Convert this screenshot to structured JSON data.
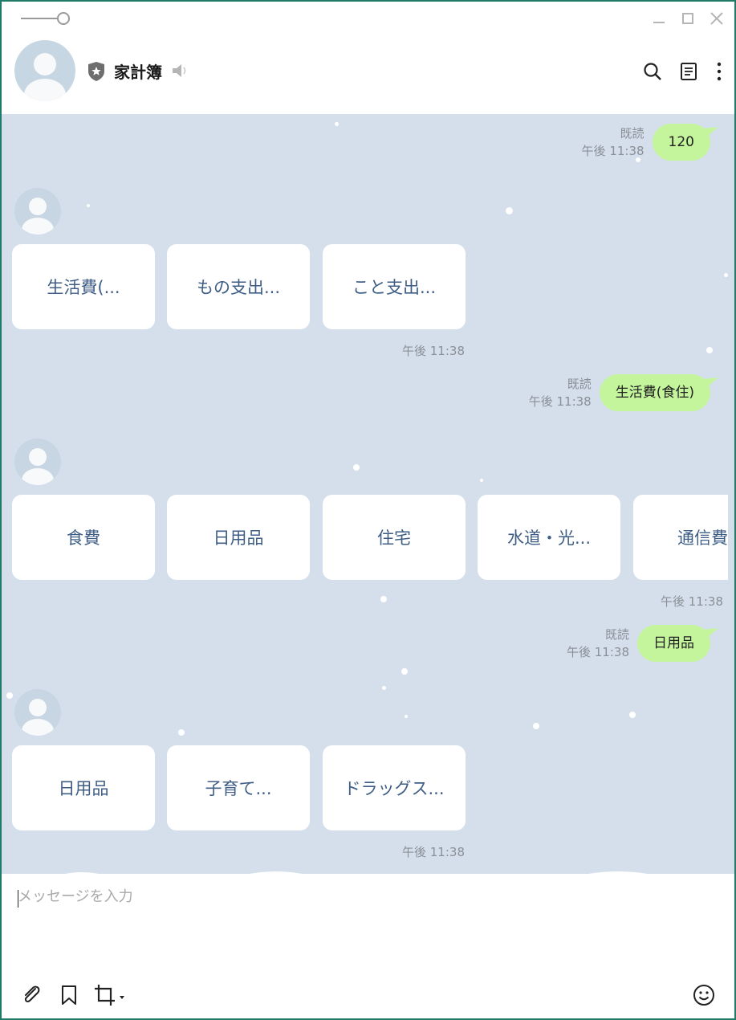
{
  "header": {
    "title": "家計簿"
  },
  "messages": [
    {
      "read": "既読",
      "time": "午後 11:38",
      "text": "120"
    },
    {
      "read": "既読",
      "time": "午後 11:38",
      "text": "生活費(食住)"
    },
    {
      "read": "既読",
      "time": "午後 11:38",
      "text": "日用品"
    }
  ],
  "card_groups": [
    {
      "cards": [
        "生活費(...",
        "もの支出...",
        "こと支出..."
      ],
      "time": "午後 11:38"
    },
    {
      "cards": [
        "食費",
        "日用品",
        "住宅",
        "水道・光...",
        "通信費"
      ],
      "time": "午後 11:38"
    },
    {
      "cards": [
        "日用品",
        "子育て...",
        "ドラッグス..."
      ],
      "time": "午後 11:38"
    }
  ],
  "composer": {
    "placeholder": "メッセージを入力"
  },
  "colors": {
    "frame": "#1f7a68",
    "chat_bg": "#d5dfec",
    "bubble_out": "#c4f59d",
    "card_text": "#3f5e86"
  }
}
